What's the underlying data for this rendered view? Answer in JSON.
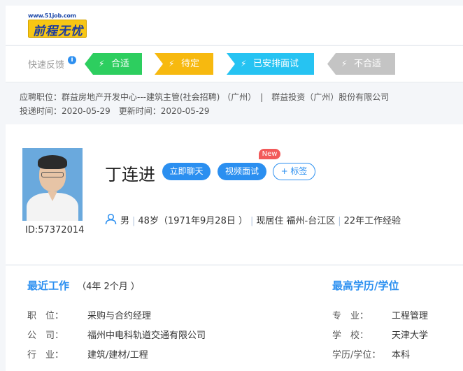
{
  "logo": {
    "url": "www.51job.com",
    "text": "前程无忧"
  },
  "feedback": {
    "label": "快速反馈",
    "info": "i",
    "tags": [
      "合适",
      "待定",
      "已安排面试",
      "不合适"
    ]
  },
  "apply": {
    "line1": "应聘职位：群益房地产开发中心---建筑主管(社会招聘) （广州）　|　群益投资（广州）股份有限公司",
    "line2": "投递时间：2020-05-29　更新时间：2020-05-29"
  },
  "profile": {
    "id": "ID:57372014",
    "name": "丁连进",
    "buttons": {
      "chat": "立即聊天",
      "video": "视频面试",
      "tag": "+ 标签"
    },
    "new_badge": "New",
    "gender": "男",
    "age": "48岁（1971年9月28日 ）",
    "residence": "现居住 福州-台江区",
    "experience": "22年工作经验",
    "separator": "|"
  },
  "recent_work": {
    "title": "最近工作",
    "duration": "（4年 2个月 ）",
    "rows": [
      {
        "label": "职　位：",
        "value": "采购与合约经理"
      },
      {
        "label": "公　司：",
        "value": "福州中电科轨道交通有限公司"
      },
      {
        "label": "行　业：",
        "value": "建筑/建材/工程"
      }
    ]
  },
  "education": {
    "title": "最高学历/学位",
    "rows": [
      {
        "label": "专　业：",
        "value": "工程管理"
      },
      {
        "label": "学　校：",
        "value": "天津大学"
      },
      {
        "label": "学历/学位：",
        "value": "本科"
      }
    ]
  },
  "colors": {
    "accent": "#2b8ff0",
    "green": "#2dce5f",
    "yellow": "#f7b90f",
    "cyan": "#26c3f2",
    "gray": "#c4c4c4",
    "new": "#f25a5a"
  }
}
